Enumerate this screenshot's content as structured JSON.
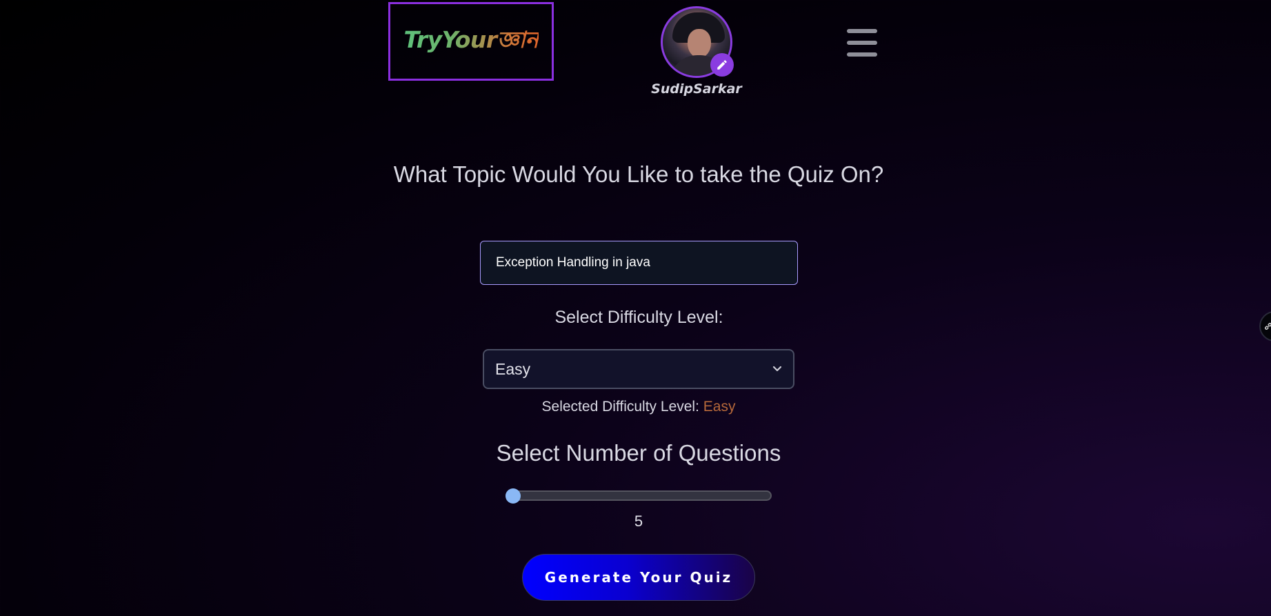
{
  "header": {
    "logo_text": "TryYourজ্ঞান",
    "username": "SudipSarkar",
    "icons": {
      "edit": "pencil-icon",
      "menu": "hamburger-menu-icon",
      "side": "link-icon"
    }
  },
  "quiz_form": {
    "heading": "What Topic Would You Like to take the Quiz On?",
    "topic_value": "Exception Handling in java",
    "difficulty_label": "Select Difficulty Level:",
    "difficulty_selected": "Easy",
    "selected_difficulty_prefix": "Selected Difficulty Level: ",
    "selected_difficulty_value": "Easy",
    "questions_heading": "Select Number of Questions",
    "questions_value": "5",
    "questions_slider_fraction": 0.0,
    "generate_label": "Generate Your Quiz"
  },
  "colors": {
    "accent_purple": "#8b2fe0",
    "difficulty_value": "#b7693a",
    "slider_thumb": "#8ab8f5",
    "button_start": "#0000ff"
  }
}
